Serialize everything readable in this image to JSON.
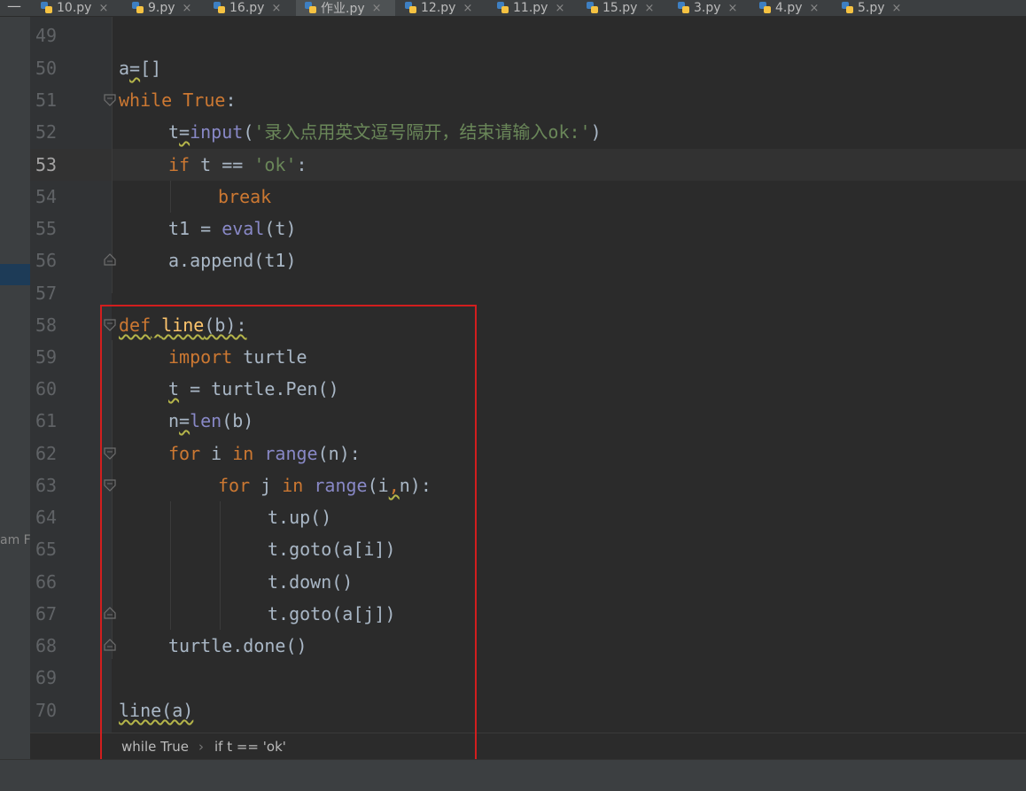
{
  "tabs": [
    {
      "label": "10.py",
      "close": "×"
    },
    {
      "label": "9.py",
      "close": "×"
    },
    {
      "label": "16.py",
      "close": "×"
    },
    {
      "label": "作业.py",
      "close": "×",
      "active": true
    },
    {
      "label": "12.py",
      "close": "×"
    },
    {
      "label": "11.py",
      "close": "×"
    },
    {
      "label": "15.py",
      "close": "×"
    },
    {
      "label": "3.py",
      "close": "×"
    },
    {
      "label": "4.py",
      "close": "×"
    },
    {
      "label": "5.py",
      "close": "×"
    }
  ],
  "tab_minimize": "—",
  "left_panel_label": "am F",
  "current_line": "53",
  "line_numbers": [
    "49",
    "50",
    "51",
    "52",
    "53",
    "54",
    "55",
    "56",
    "57",
    "58",
    "59",
    "60",
    "61",
    "62",
    "63",
    "64",
    "65",
    "66",
    "67",
    "68",
    "69",
    "70"
  ],
  "code": {
    "l50": {
      "a": "a",
      "b": "=",
      "c": "[]"
    },
    "l51": {
      "kw": "while",
      "sp": " ",
      "kw2": "True",
      "rest": ":"
    },
    "l52": {
      "a": "t",
      "b": "=",
      "fn": "input",
      "p1": "(",
      "str": "'录入点用英文逗号隔开，结束请输入ok:'",
      "p2": ")"
    },
    "l53": {
      "kw": "if",
      "mid": " t == ",
      "str": "'ok'",
      "rest": ":"
    },
    "l54": {
      "kw": "break"
    },
    "l55": {
      "a": "t1 = ",
      "fn": "eval",
      "rest": "(t)"
    },
    "l56": {
      "a": "a.append(t1)"
    },
    "l58": {
      "kw": "def",
      "sp": " ",
      "name": "line",
      "rest": "(b):"
    },
    "l59": {
      "kw": "import",
      "rest": " turtle"
    },
    "l60": {
      "a": "t",
      "rest": " = turtle.Pen()"
    },
    "l61": {
      "a": "n",
      "b": "=",
      "fn": "len",
      "rest": "(b)"
    },
    "l62": {
      "kw": "for",
      "mid": " i ",
      "kw2": "in",
      "sp": " ",
      "fn": "range",
      "rest": "(n):"
    },
    "l63": {
      "kw": "for",
      "mid": " j ",
      "kw2": "in",
      "sp": " ",
      "fn": "range",
      "p": "(i",
      "comma": ",",
      "rest": "n):"
    },
    "l64": {
      "a": "t.up()"
    },
    "l65": {
      "a": "t.goto(a[i])"
    },
    "l66": {
      "a": "t.down()"
    },
    "l67": {
      "a": "t.goto(a[j])"
    },
    "l68": {
      "a": "turtle.done()"
    },
    "l70": {
      "a": "line(a)"
    }
  },
  "breadcrumb": {
    "item1": "while True",
    "sep": "›",
    "item2": "if t == 'ok'"
  },
  "colors": {
    "keyword": "#cc7832",
    "string": "#6a8759",
    "builtin": "#8888c6",
    "function_def": "#ffc66d",
    "text": "#a9b7c6",
    "highlight_box": "#d21e1e"
  }
}
